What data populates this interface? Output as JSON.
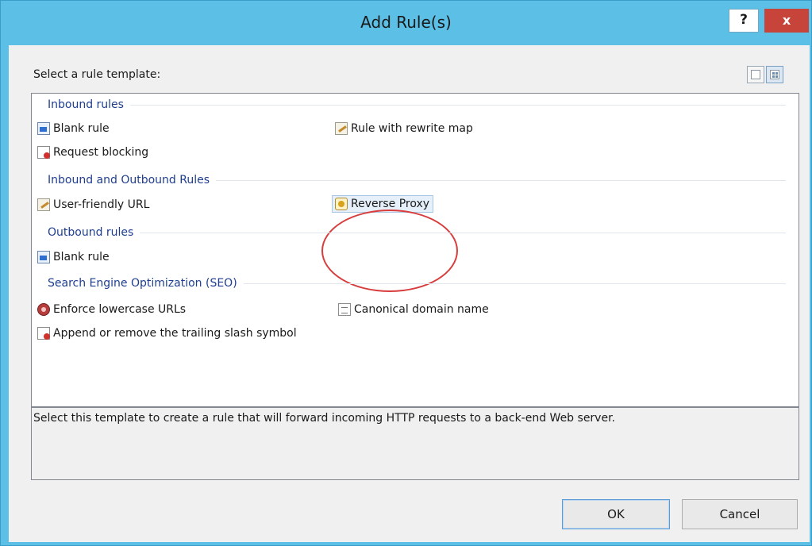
{
  "window": {
    "title": "Add Rule(s)",
    "help_label": "?",
    "close_label": "x"
  },
  "prompt": "Select a rule template:",
  "view_buttons": [
    "list-view-icon",
    "tile-view-icon"
  ],
  "groups": {
    "inbound": {
      "header": "Inbound rules",
      "items": [
        "Blank rule",
        "Rule with rewrite map",
        "Request blocking"
      ]
    },
    "inbound_outbound": {
      "header": "Inbound and Outbound Rules",
      "items": [
        "User-friendly URL",
        "Reverse Proxy"
      ]
    },
    "outbound": {
      "header": "Outbound rules",
      "items": [
        "Blank rule"
      ]
    },
    "seo": {
      "header": "Search Engine Optimization (SEO)",
      "items": [
        "Enforce lowercase URLs",
        "Canonical domain name",
        "Append or remove the trailing slash symbol"
      ]
    }
  },
  "selected_item": "Reverse Proxy",
  "description": "Select this template to create a rule that will forward incoming HTTP requests to a back-end Web server.",
  "buttons": {
    "ok": "OK",
    "cancel": "Cancel"
  },
  "colors": {
    "titlebar": "#5bbfe6",
    "group_header": "#1e3e8f",
    "highlight_ellipse": "#d83c3c",
    "close_button": "#c7443a"
  }
}
